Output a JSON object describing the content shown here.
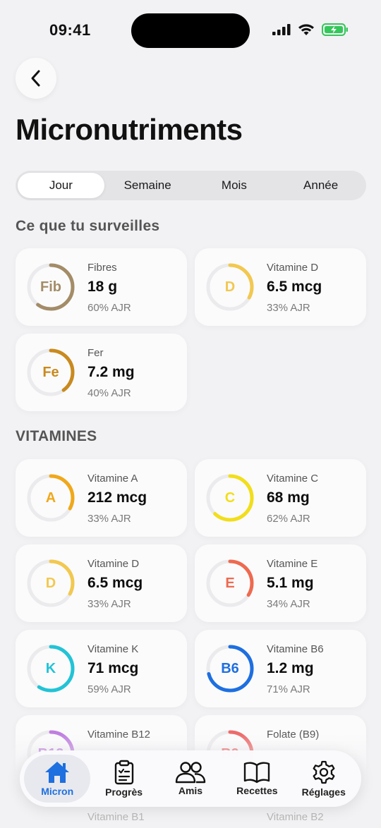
{
  "status": {
    "time": "09:41"
  },
  "header": {
    "title": "Micronutriments"
  },
  "periods": [
    {
      "label": "Jour",
      "active": true
    },
    {
      "label": "Semaine",
      "active": false
    },
    {
      "label": "Mois",
      "active": false
    },
    {
      "label": "Année",
      "active": false
    }
  ],
  "tracked": {
    "title": "Ce que tu surveilles",
    "items": [
      {
        "symbol": "Fib",
        "name": "Fibres",
        "value": "18 g",
        "pct_label": "60% AJR",
        "pct": 60,
        "color": "#a38c67"
      },
      {
        "symbol": "D",
        "name": "Vitamine D",
        "value": "6.5 mcg",
        "pct_label": "33% AJR",
        "pct": 33,
        "color": "#f2c84f"
      },
      {
        "symbol": "Fe",
        "name": "Fer",
        "value": "7.2 mg",
        "pct_label": "40% AJR",
        "pct": 40,
        "color": "#c98a1e"
      }
    ]
  },
  "vitamins": {
    "title": "VITAMINES",
    "items": [
      {
        "symbol": "A",
        "name": "Vitamine A",
        "value": "212 mcg",
        "pct_label": "33% AJR",
        "pct": 33,
        "color": "#f0a81a"
      },
      {
        "symbol": "C",
        "name": "Vitamine C",
        "value": "68 mg",
        "pct_label": "62% AJR",
        "pct": 62,
        "color": "#f2de1a"
      },
      {
        "symbol": "D",
        "name": "Vitamine D",
        "value": "6.5 mcg",
        "pct_label": "33% AJR",
        "pct": 33,
        "color": "#f2c84f"
      },
      {
        "symbol": "E",
        "name": "Vitamine E",
        "value": "5.1 mg",
        "pct_label": "34% AJR",
        "pct": 34,
        "color": "#ee6a4f"
      },
      {
        "symbol": "K",
        "name": "Vitamine K",
        "value": "71 mcg",
        "pct_label": "59% AJR",
        "pct": 59,
        "color": "#22c3d6"
      },
      {
        "symbol": "B6",
        "name": "Vitamine B6",
        "value": "1.2 mg",
        "pct_label": "71% AJR",
        "pct": 71,
        "color": "#1e6fe0"
      },
      {
        "symbol": "B12",
        "name": "Vitamine B12",
        "value": "",
        "pct_label": "",
        "pct": 45,
        "color": "#c07ee0"
      },
      {
        "symbol": "B9",
        "name": "Folate (B9)",
        "value": "",
        "pct_label": "",
        "pct": 40,
        "color": "#ee6a6a"
      }
    ],
    "next_labels": [
      "Vitamine B1",
      "Vitamine B2"
    ]
  },
  "tabbar": {
    "items": [
      {
        "label": "Micron",
        "icon": "home-icon",
        "active": true
      },
      {
        "label": "Progrès",
        "icon": "clipboard-icon",
        "active": false
      },
      {
        "label": "Amis",
        "icon": "people-icon",
        "active": false
      },
      {
        "label": "Recettes",
        "icon": "book-icon",
        "active": false
      },
      {
        "label": "Réglages",
        "icon": "gear-icon",
        "active": false
      }
    ]
  }
}
